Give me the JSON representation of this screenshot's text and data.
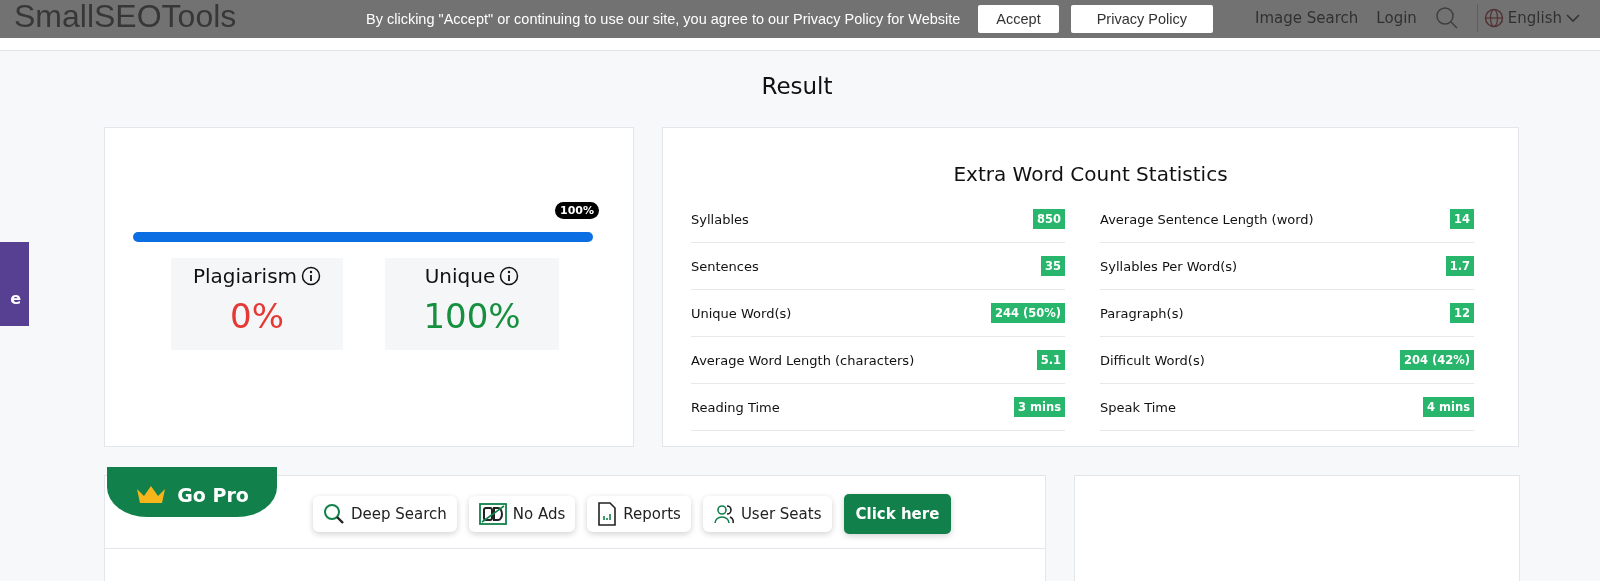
{
  "header": {
    "logo": "SmallSEOTools",
    "nav": [
      "Image Search",
      "Login"
    ],
    "language": "English"
  },
  "cookie_banner": {
    "text": "By clicking \"Accept\" or continuing to use our site, you agree to our Privacy Policy for Website",
    "buttons": [
      "Accept",
      "Privacy Policy"
    ]
  },
  "side_tab": {
    "label": "e"
  },
  "result": {
    "title": "Result",
    "progress": {
      "level": 1,
      "tooltip": "100%"
    },
    "scores": [
      {
        "label": "Plagiarism",
        "value": "0%",
        "kind": "bad"
      },
      {
        "label": "Unique",
        "value": "100%",
        "kind": "good"
      }
    ]
  },
  "statistics": {
    "title": "Extra Word Count Statistics",
    "items": [
      {
        "label": "Syllables",
        "value": "850"
      },
      {
        "label": "Average Sentence Length (word)",
        "value": "14"
      },
      {
        "label": "Sentences",
        "value": "35"
      },
      {
        "label": "Syllables Per Word(s)",
        "value": "1.7"
      },
      {
        "label": "Unique Word(s)",
        "value": "244 (50%)"
      },
      {
        "label": "Paragraph(s)",
        "value": "12"
      },
      {
        "label": "Average Word Length (characters)",
        "value": "5.1"
      },
      {
        "label": "Difficult Word(s)",
        "value": "204 (42%)"
      },
      {
        "label": "Reading Time",
        "value": "3 mins"
      },
      {
        "label": "Speak Time",
        "value": "4 mins"
      }
    ]
  },
  "go_pro": {
    "title": "Go Pro",
    "features": [
      {
        "label": "Deep Search",
        "kind": "search"
      },
      {
        "label": "No Ads",
        "kind": "noads"
      },
      {
        "label": "Reports",
        "kind": "report"
      },
      {
        "label": "User Seats",
        "kind": "users"
      }
    ],
    "cta": "Click here"
  }
}
